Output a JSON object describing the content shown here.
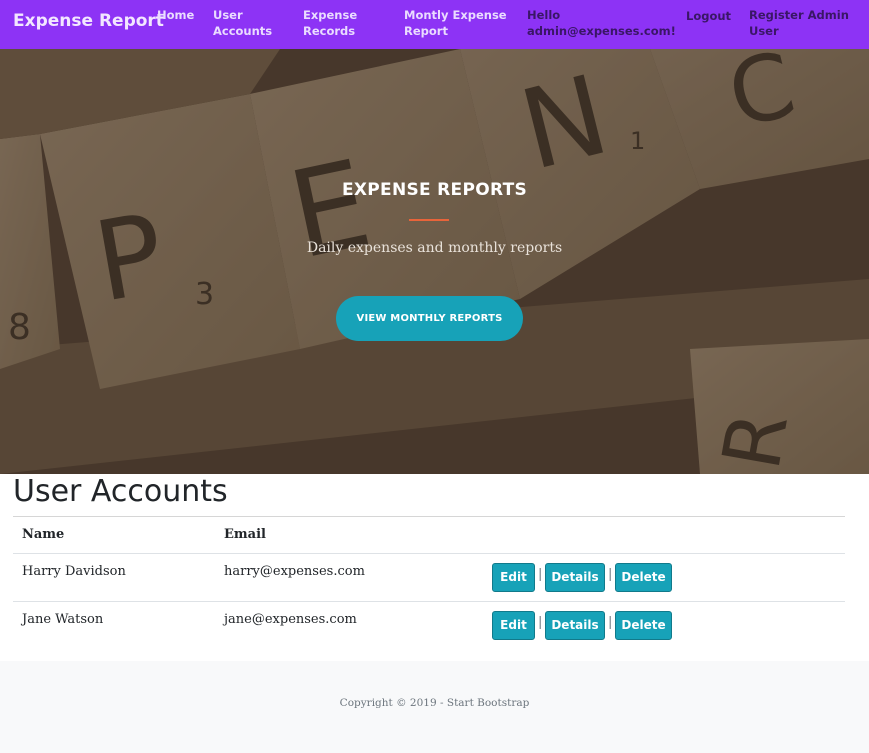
{
  "navbar": {
    "brand": "Expense Report",
    "links": {
      "home": "Home",
      "user_accounts": "User Accounts",
      "expense_records": "Expense Records",
      "monthly_report": "Montly Expense Report",
      "hello": "Hello admin@expenses.com!",
      "logout": "Logout",
      "register": "Register Admin User"
    },
    "color": "#8d33f5"
  },
  "hero": {
    "title": "EXPENSE REPORTS",
    "subtitle": "Daily expenses and monthly reports",
    "button_label": "VIEW MONTHLY REPORTS",
    "accent_color": "#e8643a",
    "button_color": "#17a2b8"
  },
  "main": {
    "title": "User Accounts",
    "columns": [
      "Name",
      "Email"
    ],
    "rows": [
      {
        "name": "Harry Davidson",
        "email": "harry@expenses.com"
      },
      {
        "name": "Jane Watson",
        "email": "jane@expenses.com"
      }
    ],
    "actions": {
      "edit": "Edit",
      "details": "Details",
      "delete": "Delete",
      "separator": "|"
    }
  },
  "footer": {
    "text": "Copyright © 2019 - Start Bootstrap"
  }
}
